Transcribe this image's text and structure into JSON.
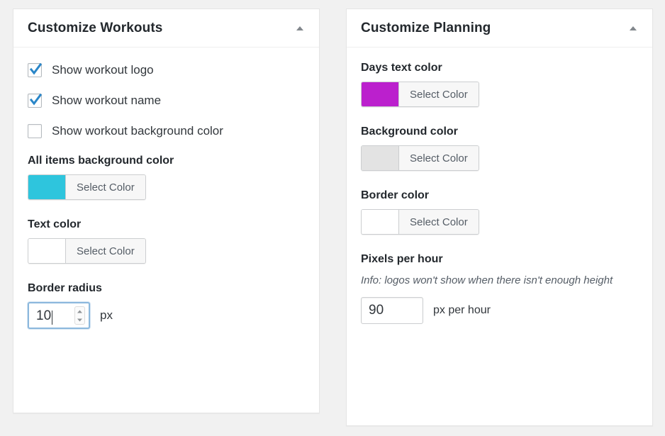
{
  "panels": [
    {
      "title": "Customize Workouts",
      "toggle_icon": "triangle-up-icon",
      "checkboxes": [
        {
          "label": "Show workout logo",
          "checked": true
        },
        {
          "label": "Show workout name",
          "checked": true
        },
        {
          "label": "Show workout background color",
          "checked": false
        }
      ],
      "colors": [
        {
          "label": "All items background color",
          "button_label": "Select Color",
          "swatch": "#2ec5dd"
        },
        {
          "label": "Text color",
          "button_label": "Select Color",
          "swatch": "#ffffff"
        }
      ],
      "number": {
        "label": "Border radius",
        "value": "10",
        "unit": "px",
        "focused": true
      }
    },
    {
      "title": "Customize Planning",
      "toggle_icon": "triangle-up-icon",
      "colors": [
        {
          "label": "Days text color",
          "button_label": "Select Color",
          "swatch": "#bb20cd"
        },
        {
          "label": "Background color",
          "button_label": "Select Color",
          "swatch": "#e3e3e3"
        },
        {
          "label": "Border color",
          "button_label": "Select Color",
          "swatch": "#ffffff"
        }
      ],
      "number": {
        "label": "Pixels per hour",
        "info": "Info: logos won't show when there isn't enough height",
        "value": "90",
        "unit": "px per hour",
        "focused": false
      }
    }
  ],
  "theme": {
    "page_background": "#f1f1f1",
    "panel_background": "#ffffff",
    "checkmark_color": "#2a86c8",
    "focus_border": "#8cb8dd"
  }
}
